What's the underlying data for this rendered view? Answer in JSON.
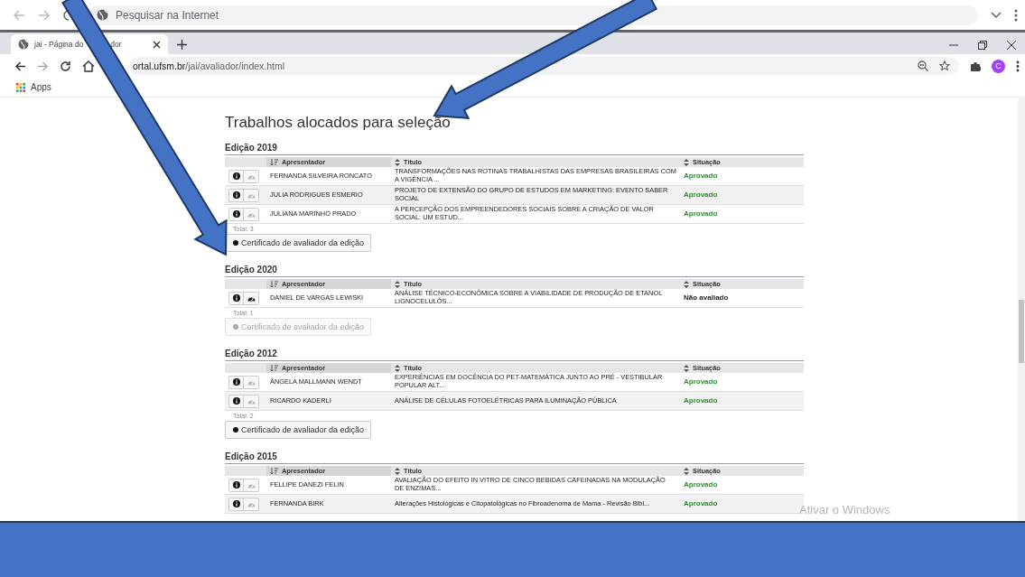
{
  "outer_bar": {
    "search_placeholder": "Pesquisar na Internet"
  },
  "tab": {
    "title_start": "jai - Página do",
    "title_end": "dor"
  },
  "address": {
    "host": "ortal.ufsm.br",
    "path": "/jai/avaliador/index.html"
  },
  "avatar": "C",
  "bookmarks": [
    {
      "label": "Apps"
    }
  ],
  "page_title": "Trabalhos alocados para seleção",
  "editions": [
    {
      "heading": "Edição 2019",
      "columns": [
        "Apresentador",
        "Título",
        "Situação"
      ],
      "rows": [
        {
          "presenter": "FERNANDA SILVEIRA RONCATO",
          "title": "TRANSFORMAÇÕES NAS ROTINAS TRABALHISTAS DAS EMPRESAS BRASILEIRAS COM A VIGÊNCIA ...",
          "status": "Aprovado",
          "color": "#2e8b2e",
          "certificate_enabled": false
        },
        {
          "presenter": "JULIA RODRIGUES ESMERIO",
          "title": "PROJETO DE EXTENSÃO DO GRUPO DE ESTUDOS EM MARKETING: EVENTO SABER SOCIAL",
          "status": "Aprovado",
          "color": "#2e8b2e",
          "certificate_enabled": false
        },
        {
          "presenter": "JULIANA MARINHO PRADO",
          "title": "A PERCEPÇÃO DOS EMPREENDEDORES SOCIAIS SOBRE A CRIAÇÃO DE VALOR SOCIAL: UM ESTUD...",
          "status": "Aprovado",
          "color": "#2e8b2e",
          "certificate_enabled": false
        }
      ],
      "total": "Total: 3",
      "certificate_button": {
        "label": "Certificado de avaliador da edição",
        "disabled": false
      }
    },
    {
      "heading": "Edição 2020",
      "columns": [
        "Apresentador",
        "Título",
        "Situação"
      ],
      "rows": [
        {
          "presenter": "DANIEL DE VARGAS LEWISKI",
          "title": "ANÁLISE TÉCNICO-ECONÔMICA SOBRE A VIABILIDADE DE PRODUÇÃO DE ETANOL LIGNOCELULÓS...",
          "status": "Não avaliado",
          "color": "#222222",
          "certificate_enabled": true
        }
      ],
      "total": "Total: 1",
      "certificate_button": {
        "label": "Certificado de avaliador da edição",
        "disabled": true
      }
    },
    {
      "heading": "Edição 2012",
      "columns": [
        "Apresentador",
        "Título",
        "Situação"
      ],
      "rows": [
        {
          "presenter": "ÂNGELA MALLMANN WENDT",
          "title": "EXPERIÊNCIAS EM DOCÊNCIA DO PET-MATEMÁTICA JUNTO AO PRÉ - VESTIBULAR POPULAR ALT...",
          "status": "Aprovado",
          "color": "#2e8b2e",
          "certificate_enabled": false
        },
        {
          "presenter": "RICARDO KADERLI",
          "title": "ANÁLISE DE CÉLULAS FOTOELÉTRICAS PARA ILUMINAÇÃO PÚBLICA",
          "status": "Aprovado",
          "color": "#2e8b2e",
          "certificate_enabled": false
        }
      ],
      "total": "Total: 2",
      "certificate_button": {
        "label": "Certificado de avaliador da edição",
        "disabled": false
      }
    },
    {
      "heading": "Edição 2015",
      "columns": [
        "Apresentador",
        "Título",
        "Situação"
      ],
      "rows": [
        {
          "presenter": "FELLIPE DANEZI FELIN",
          "title": "AVALIAÇÃO DO EFEITO IN VITRO DE CINCO BEBIDAS CAFEINADAS NA MODULAÇÃO DE ENZIMAS...",
          "status": "Aprovado",
          "color": "#2e8b2e",
          "certificate_enabled": false
        },
        {
          "presenter": "FERNANDA BIRK",
          "title": "Alterações Histológicas e Citopatológicas no Fibroadenoma de Mama - Revisão Bibl...",
          "status": "Aprovado",
          "color": "#2e8b2e",
          "certificate_enabled": false
        }
      ]
    }
  ],
  "os_notice": "Ativar o Windows"
}
